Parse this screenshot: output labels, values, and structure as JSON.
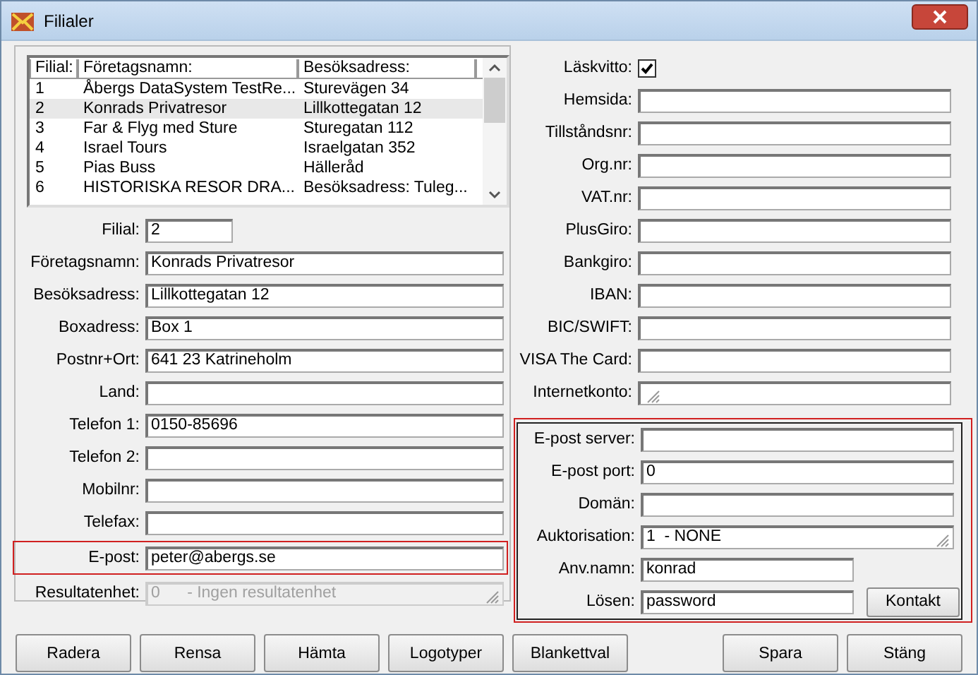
{
  "window": {
    "title": "Filialer"
  },
  "branch_list": {
    "columns": [
      "Filial:",
      "Företagsnamn:",
      "Besöksadress:"
    ],
    "rows": [
      {
        "cells": [
          "1",
          "Åbergs DataSystem TestRe...",
          "Sturevägen 34"
        ],
        "selected": false
      },
      {
        "cells": [
          "2",
          "Konrads Privatresor",
          "Lillkottegatan 12"
        ],
        "selected": true
      },
      {
        "cells": [
          "3",
          "Far & Flyg med Sture",
          "Sturegatan 112"
        ],
        "selected": false
      },
      {
        "cells": [
          "4",
          "Israel Tours",
          "Israelgatan 352"
        ],
        "selected": false
      },
      {
        "cells": [
          "5",
          "Pias Buss",
          "Hälleråd"
        ],
        "selected": false
      },
      {
        "cells": [
          "6",
          "HISTORISKA RESOR DRA...",
          "Besöksadress: Tuleg..."
        ],
        "selected": false
      }
    ]
  },
  "left_fields": [
    {
      "kind": "short",
      "label": "Filial:",
      "value": "2",
      "highlighted": false
    },
    {
      "kind": "text",
      "label": "Företagsnamn:",
      "value": "Konrads Privatresor",
      "highlighted": false
    },
    {
      "kind": "text",
      "label": "Besöksadress:",
      "value": "Lillkottegatan 12",
      "highlighted": false
    },
    {
      "kind": "text",
      "label": "Boxadress:",
      "value": "Box 1",
      "highlighted": false
    },
    {
      "kind": "text",
      "label": "Postnr+Ort:",
      "value": "641 23 Katrineholm",
      "highlighted": false
    },
    {
      "kind": "text",
      "label": "Land:",
      "highlighted": false
    },
    {
      "kind": "text",
      "label": "Telefon 1:",
      "value": "0150-85696",
      "highlighted": false
    },
    {
      "kind": "text",
      "label": "Telefon 2:",
      "highlighted": false
    },
    {
      "kind": "text",
      "label": "Mobilnr:",
      "highlighted": false
    },
    {
      "kind": "text",
      "label": "Telefax:",
      "highlighted": false
    },
    {
      "kind": "text",
      "label": "E-post:",
      "value": "peter@abergs.se",
      "highlighted": true
    },
    {
      "kind": "select",
      "label": "Resultatenhet:",
      "value": "0      - Ingen resultatenhet",
      "disabled": true,
      "highlighted": false
    }
  ],
  "right_fields": [
    {
      "kind": "checkbox",
      "label": "Läskvitto:",
      "checked": true
    },
    {
      "kind": "text",
      "label": "Hemsida:"
    },
    {
      "kind": "text",
      "label": "Tillståndsnr:"
    },
    {
      "kind": "text",
      "label": "Org.nr:"
    },
    {
      "kind": "text",
      "label": "VAT.nr:"
    },
    {
      "kind": "text",
      "label": "PlusGiro:"
    },
    {
      "kind": "text",
      "label": "Bankgiro:"
    },
    {
      "kind": "text",
      "label": "IBAN:"
    },
    {
      "kind": "text",
      "label": "BIC/SWIFT:"
    },
    {
      "kind": "text",
      "label": "VISA The Card:"
    },
    {
      "kind": "select",
      "label": "Internetkonto:",
      "disabled": false
    }
  ],
  "email_settings": {
    "fields": [
      {
        "kind": "text",
        "label": "E-post server:"
      },
      {
        "kind": "text",
        "label": "E-post port:",
        "value": "0"
      },
      {
        "kind": "text",
        "label": "Domän:"
      },
      {
        "kind": "select",
        "label": "Auktorisation:",
        "value": "1  - NONE",
        "disabled": false
      },
      {
        "kind": "medium",
        "label": "Anv.namn:",
        "value": "konrad"
      },
      {
        "kind": "medium",
        "label": "Lösen:",
        "value": "password"
      }
    ],
    "button": "Kontakt"
  },
  "buttons_left": [
    "Radera",
    "Rensa",
    "Hämta",
    "Logotyper",
    "Blankettval"
  ],
  "buttons_right": [
    "Spara",
    "Stäng"
  ]
}
